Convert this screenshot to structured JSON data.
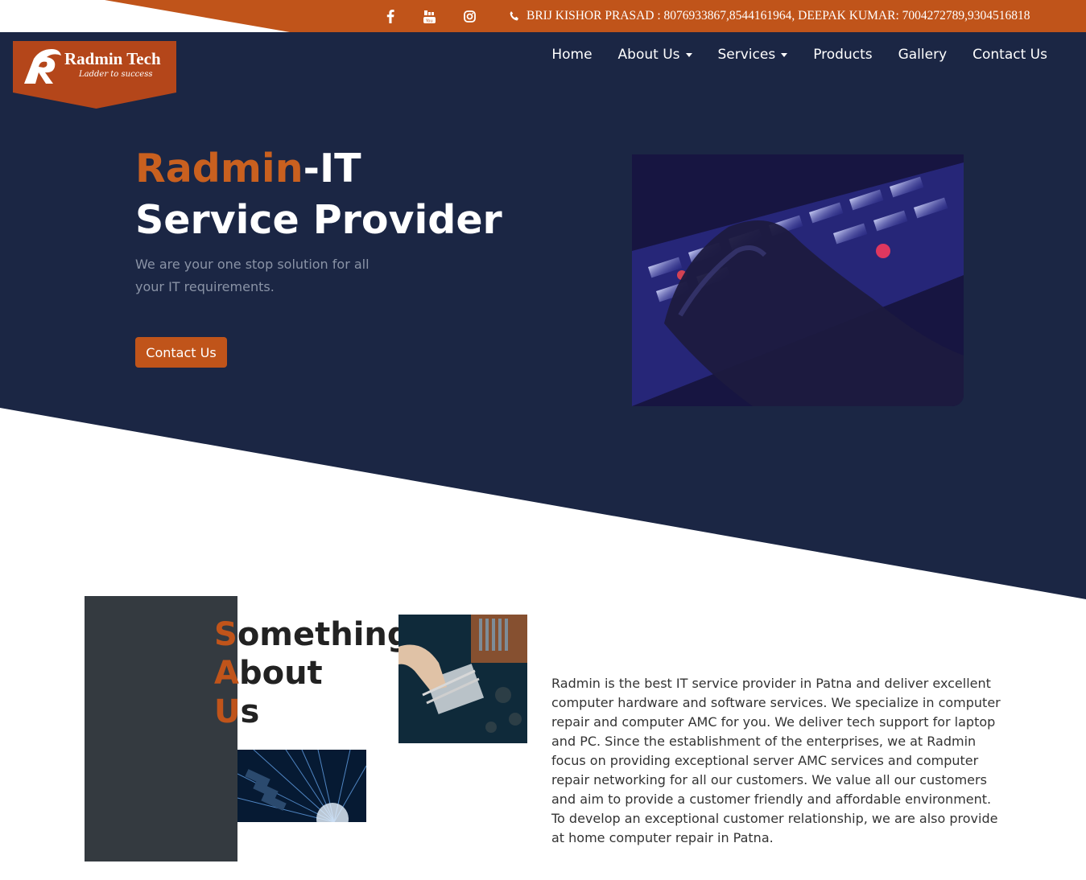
{
  "topbar": {
    "social": [
      {
        "name": "facebook-icon"
      },
      {
        "name": "youtube-icon"
      },
      {
        "name": "instagram-icon"
      }
    ],
    "contact_text": "BRIJ KISHOR PRASAD  : 8076933867,8544161964,  DEEPAK KUMAR: 7004272789,9304516818"
  },
  "logo": {
    "name": "Radmin Tech",
    "tagline": "Ladder to success"
  },
  "nav": {
    "items": [
      {
        "label": "Home"
      },
      {
        "label": "About Us"
      },
      {
        "label": "Services"
      },
      {
        "label": "Products"
      },
      {
        "label": "Gallery"
      },
      {
        "label": "Contact Us"
      }
    ]
  },
  "hero": {
    "title_accent": "Radmin",
    "title_rest": "-IT",
    "title_line2": "Service Provider",
    "subtitle": "We are your one stop solution for all your IT requirements.",
    "cta_label": "Contact Us"
  },
  "about": {
    "title_line1_first": "S",
    "title_line1_rest": "omething",
    "title_line2_first": "A",
    "title_line2_rest": "bout",
    "title_line3_first": "U",
    "title_line3_rest": "s",
    "body": "Radmin is the best IT service provider in Patna and deliver excellent computer hardware and software services. We specialize in computer repair and computer AMC for you. We deliver tech support for laptop and PC. Since the establishment of the enterprises, we at Radmin focus on providing exceptional server AMC services and computer repair networking for all our customers. We value all our customers and aim to provide a customer friendly and affordable environment. To develop an exceptional customer relationship, we are also provide at home computer repair in Patna."
  },
  "colors": {
    "navy": "#1b2644",
    "orange": "#c0541a",
    "dark_panel": "#343a40"
  }
}
